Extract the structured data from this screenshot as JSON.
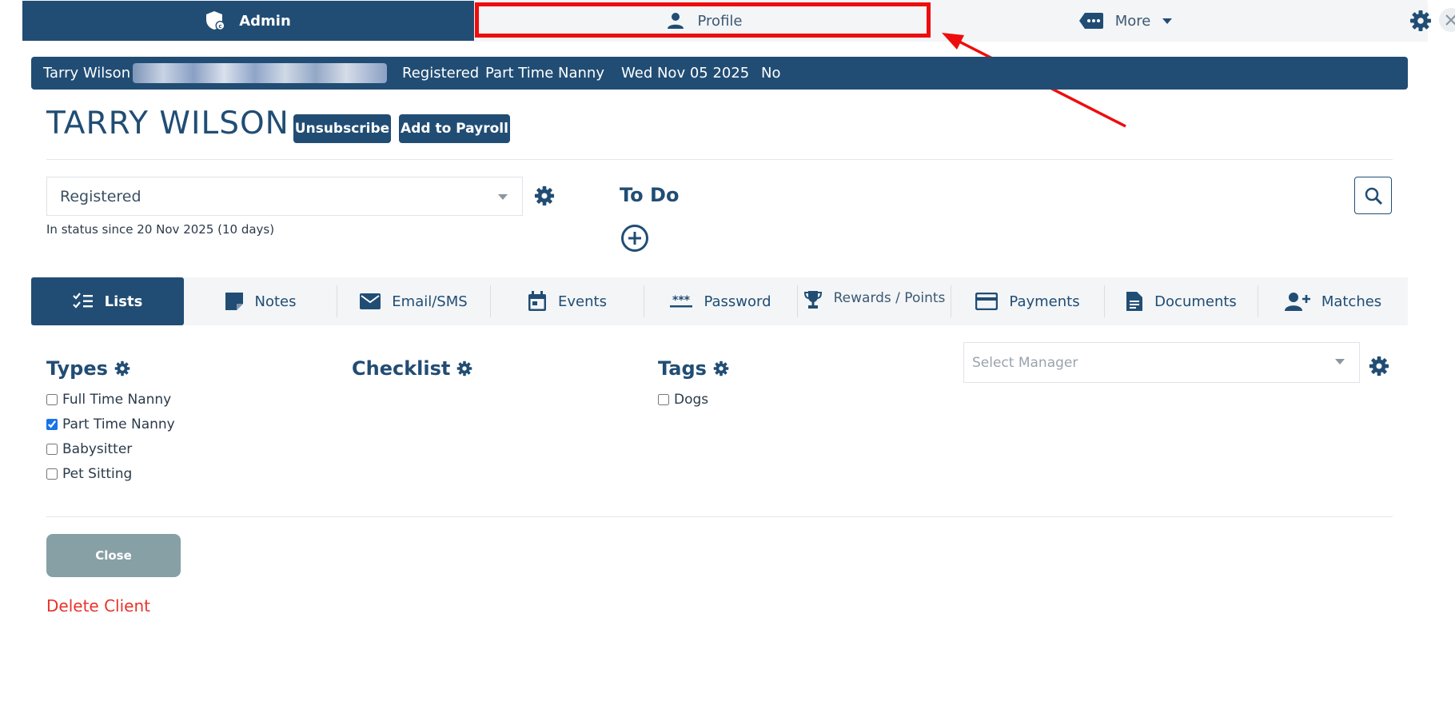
{
  "nav": {
    "admin_label": "Admin",
    "profile_label": "Profile",
    "more_label": "More"
  },
  "infobar": {
    "name": "Tarry Wilson",
    "status": "Registered",
    "type": "Part Time Nanny",
    "date": "Wed Nov 05 2025",
    "flag": "No"
  },
  "client": {
    "name": "TARRY WILSON",
    "unsubscribe_label": "Unsubscribe",
    "payroll_label": "Add to Payroll"
  },
  "status": {
    "value": "Registered",
    "since": "In status since 20 Nov 2025 (10 days)"
  },
  "todo": {
    "title": "To Do"
  },
  "tabs": [
    {
      "label": "Lists",
      "icon": "checklist-icon"
    },
    {
      "label": "Notes",
      "icon": "note-icon"
    },
    {
      "label": "Email/SMS",
      "icon": "envelope-icon"
    },
    {
      "label": "Events",
      "icon": "calendar-icon"
    },
    {
      "label": "Password",
      "icon": "password-icon"
    },
    {
      "label": "Rewards / Points",
      "icon": "trophy-icon"
    },
    {
      "label": "Payments",
      "icon": "credit-card-icon"
    },
    {
      "label": "Documents",
      "icon": "document-icon"
    },
    {
      "label": "Matches",
      "icon": "add-user-icon"
    }
  ],
  "types": {
    "title": "Types",
    "items": [
      {
        "label": "Full Time Nanny",
        "checked": false
      },
      {
        "label": "Part Time Nanny",
        "checked": true
      },
      {
        "label": "Babysitter",
        "checked": false
      },
      {
        "label": "Pet Sitting",
        "checked": false
      }
    ]
  },
  "checklist": {
    "title": "Checklist"
  },
  "tags": {
    "title": "Tags",
    "items": [
      {
        "label": "Dogs",
        "checked": false
      }
    ]
  },
  "manager": {
    "placeholder": "Select Manager"
  },
  "actions": {
    "close_label": "Close",
    "delete_label": "Delete Client"
  },
  "colors": {
    "primary": "#214d74",
    "highlight": "#ee0d0d",
    "danger": "#e8332a",
    "close_button": "#87a0a6"
  }
}
